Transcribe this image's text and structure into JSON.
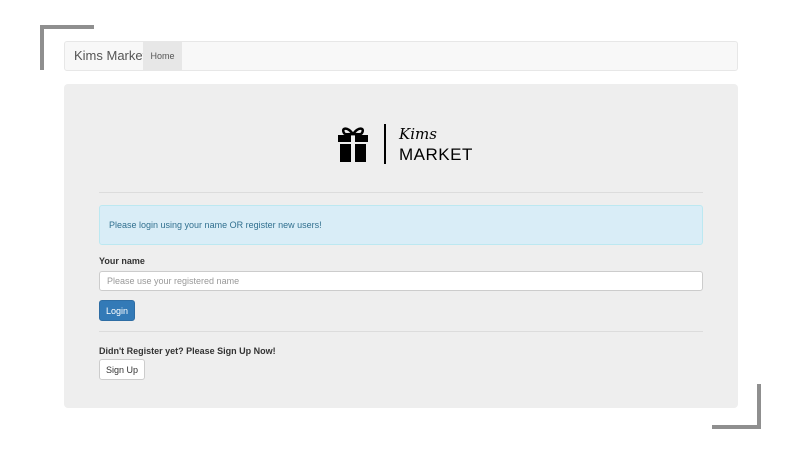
{
  "navbar": {
    "brand": "Kims Market",
    "items": [
      {
        "label": "Home",
        "active": true
      }
    ]
  },
  "logo": {
    "line1": "Kims",
    "line2": "MARKET",
    "icon": "gift-icon"
  },
  "alert": {
    "text": "Please login using your name OR register new users!"
  },
  "login_form": {
    "name_label": "Your name",
    "name_placeholder": "Please use your registered name",
    "name_value": "",
    "login_button": "Login"
  },
  "signup": {
    "prompt": "Didn't Register yet? Please Sign Up Now!",
    "button": "Sign Up"
  },
  "colors": {
    "primary": "#337ab7",
    "alert_bg": "#d9edf7",
    "alert_text": "#31708f",
    "panel_bg": "#eeeeee"
  }
}
